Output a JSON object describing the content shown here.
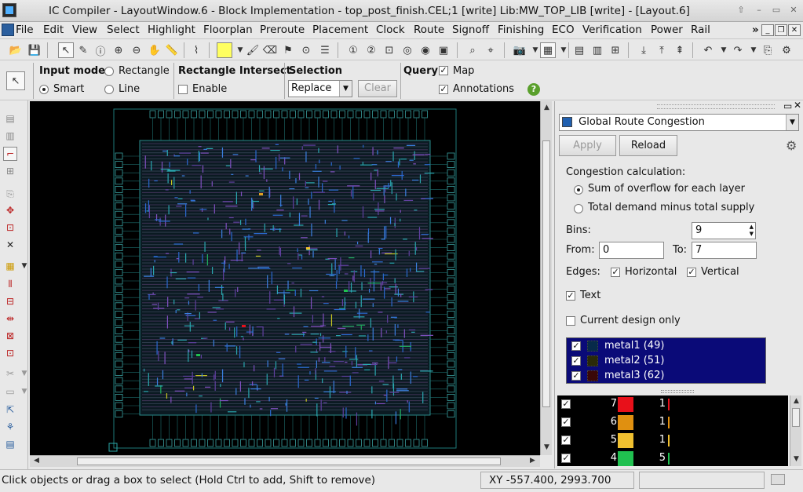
{
  "window": {
    "title": "IC Compiler - LayoutWindow.6 - Block Implementation - top_post_finish.CEL;1 [write]   Lib:MW_TOP_LIB [write] - [Layout.6]",
    "controls": [
      "⇧",
      "–",
      "▭",
      "✕"
    ]
  },
  "menu": {
    "items": [
      {
        "label": "File",
        "key": "F"
      },
      {
        "label": "Edit",
        "key": "E"
      },
      {
        "label": "View",
        "key": "V"
      },
      {
        "label": "Select",
        "key": "S"
      },
      {
        "label": "Highlight",
        "key": "H"
      },
      {
        "label": "Floorplan",
        "key": "F"
      },
      {
        "label": "Preroute",
        "key": "P"
      },
      {
        "label": "Placement",
        "key": "P"
      },
      {
        "label": "Clock",
        "key": "C"
      },
      {
        "label": "Route",
        "key": "R"
      },
      {
        "label": "Signoff",
        "key": "S"
      },
      {
        "label": "Finishing",
        "key": "F"
      },
      {
        "label": "ECO",
        "key": "E"
      },
      {
        "label": "Verification",
        "key": "V"
      },
      {
        "label": "Power",
        "key": "P"
      },
      {
        "label": "Rail",
        "key": "R"
      }
    ],
    "overflow": "»"
  },
  "options": {
    "input_mode_label": "Input mode",
    "rectangle_label": "Rectangle",
    "smart_label": "Smart",
    "line_label": "Line",
    "rect_intersect_label": "Rectangle Intersect",
    "enable_label": "Enable",
    "selection_label": "Selection",
    "selection_value": "Replace",
    "clear_label": "Clear",
    "query_label": "Query",
    "map_label": "Map",
    "annotations_label": "Annotations",
    "help_icon": "?"
  },
  "panel": {
    "map_type": "Global Route Congestion",
    "apply_label": "Apply",
    "reload_label": "Reload",
    "congestion_calc_label": "Congestion calculation:",
    "opt_sum_label": "Sum of overflow for each layer",
    "opt_total_label": "Total demand minus total supply",
    "bins_label": "Bins:",
    "bins_value": "9",
    "from_label": "From:",
    "from_value": "0",
    "to_label": "To:",
    "to_value": "7",
    "edges_label": "Edges:",
    "horizontal_label": "Horizontal",
    "vertical_label": "Vertical",
    "text_label": "Text",
    "current_design_label": "Current design only",
    "layers": [
      {
        "name": "metal1 (49)",
        "swatch": "#2aa8b0"
      },
      {
        "name": "metal2 (51)",
        "swatch": "#c8c820"
      },
      {
        "name": "metal3 (62)",
        "swatch": "#c02020"
      }
    ],
    "bins": [
      {
        "bin": "7",
        "color": "#e8101a",
        "count": "1"
      },
      {
        "bin": "6",
        "color": "#e09010",
        "count": "1"
      },
      {
        "bin": "5",
        "color": "#f0c030",
        "count": "1"
      },
      {
        "bin": "4",
        "color": "#20c050",
        "count": "5"
      }
    ]
  },
  "status": {
    "message": "Click objects or drag a box to select (Hold Ctrl to add, Shift to remove)",
    "coordinates": "XY -557.400, 2993.700"
  }
}
